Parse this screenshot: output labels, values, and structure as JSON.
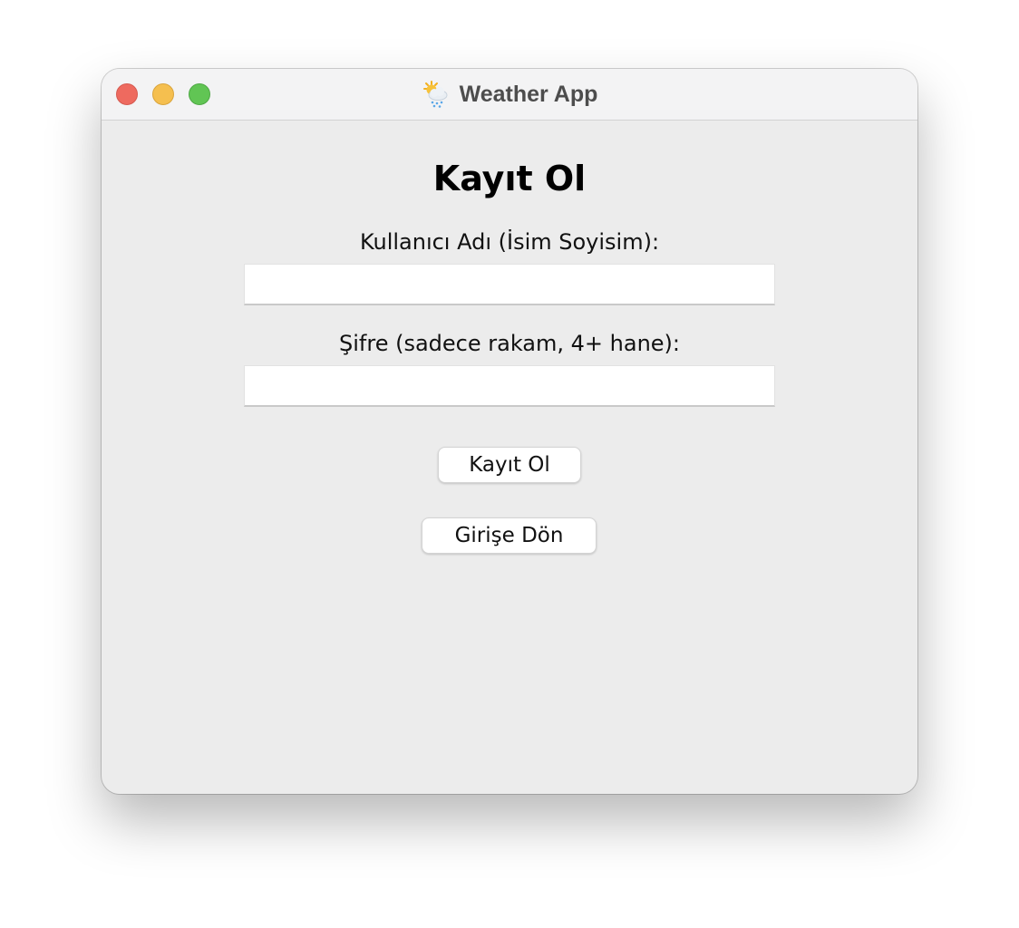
{
  "window": {
    "title": "Weather App",
    "title_icon": "sun-behind-rain-cloud-icon",
    "controls": {
      "close_color": "#ee6a5f",
      "minimize_color": "#f5bf4f",
      "zoom_color": "#61c554"
    }
  },
  "form": {
    "heading": "Kayıt Ol",
    "username": {
      "label": "Kullanıcı Adı (İsim Soyisim):",
      "value": "",
      "placeholder": ""
    },
    "password": {
      "label": "Şifre (sadece rakam, 4+ hane):",
      "value": "",
      "placeholder": ""
    },
    "register_button": "Kayıt Ol",
    "back_button": "Girişe Dön"
  }
}
